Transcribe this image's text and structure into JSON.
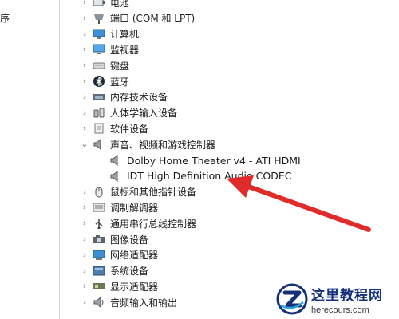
{
  "left_pane": {
    "fragment": "序"
  },
  "tree": {
    "items": [
      {
        "label": "电池",
        "icon": "battery-icon",
        "expanded": false
      },
      {
        "label": "端口 (COM 和 LPT)",
        "icon": "port-icon",
        "expanded": false
      },
      {
        "label": "计算机",
        "icon": "computer-icon",
        "expanded": false
      },
      {
        "label": "监视器",
        "icon": "monitor-icon",
        "expanded": false
      },
      {
        "label": "键盘",
        "icon": "keyboard-icon",
        "expanded": false
      },
      {
        "label": "蓝牙",
        "icon": "bluetooth-icon",
        "expanded": false
      },
      {
        "label": "内存技术设备",
        "icon": "memory-device-icon",
        "expanded": false
      },
      {
        "label": "人体学输入设备",
        "icon": "hid-icon",
        "expanded": false
      },
      {
        "label": "软件设备",
        "icon": "software-device-icon",
        "expanded": false
      },
      {
        "label": "声音、视频和游戏控制器",
        "icon": "speaker-icon",
        "expanded": true,
        "children": [
          {
            "label": "Dolby Home Theater v4 - ATI HDMI",
            "icon": "speaker-icon"
          },
          {
            "label": "IDT High Definition Audio CODEC",
            "icon": "speaker-icon"
          }
        ]
      },
      {
        "label": "鼠标和其他指针设备",
        "icon": "mouse-icon",
        "expanded": false
      },
      {
        "label": "调制解调器",
        "icon": "modem-icon",
        "expanded": false
      },
      {
        "label": "通用串行总线控制器",
        "icon": "usb-icon",
        "expanded": false
      },
      {
        "label": "图像设备",
        "icon": "camera-icon",
        "expanded": false
      },
      {
        "label": "网络适配器",
        "icon": "network-adapter-icon",
        "expanded": false
      },
      {
        "label": "系统设备",
        "icon": "system-device-icon",
        "expanded": false
      },
      {
        "label": "显示适配器",
        "icon": "display-adapter-icon",
        "expanded": false
      },
      {
        "label": "音频输入和输出",
        "icon": "audio-io-icon",
        "expanded": false
      }
    ]
  },
  "annotation": {
    "arrow_color": "#e12b2b"
  },
  "watermark": {
    "title": "这里教程网",
    "domain": "herecours.com",
    "color": "#15307a"
  }
}
